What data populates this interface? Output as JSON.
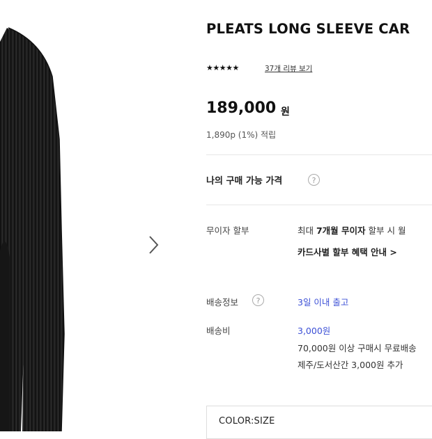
{
  "product": {
    "title": "PLEATS LONG SLEEVE CAR",
    "stars": "★★★★★",
    "review_link": "37개 리뷰 보기",
    "price": "189,000",
    "price_unit": "원",
    "points": "1,890p (1%) 적립"
  },
  "my_price": {
    "label": "나의 구매 가능 가격"
  },
  "installment": {
    "label": "무이자 할부",
    "line1_prefix": "최대 ",
    "line1_emph": "7개월 무이자",
    "line1_suffix": " 할부 시 월",
    "line2": "카드사별 할부 혜택 안내 >"
  },
  "shipping": {
    "label": "배송정보",
    "value": "3일 이내 출고"
  },
  "shipping_fee": {
    "label": "배송비",
    "value": "3,000원",
    "note1": "70,000원 이상 구매시 무료배송",
    "note2": "제주/도서산간 3,000원 추가"
  },
  "options": {
    "label": "COLOR:SIZE"
  },
  "icons": {
    "help": "?",
    "next": "chevron-right-icon"
  },
  "colors": {
    "accent_blue": "#3b4fd6",
    "garment": "#1c1c1c"
  }
}
